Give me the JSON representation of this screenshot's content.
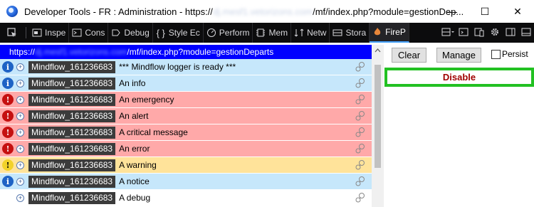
{
  "window": {
    "title_prefix": "Developer Tools - FR : Administration - https://",
    "title_blur": "dj.mesf1.vetorizons.com",
    "title_suffix": "/mf/index.php?module=gestionDep...",
    "minimize_glyph": "—",
    "maximize_glyph": "☐",
    "close_glyph": "✕"
  },
  "toolbar": {
    "tabs": [
      {
        "label": "Inspe",
        "icon": "inspector-icon"
      },
      {
        "label": "Cons",
        "icon": "console-icon"
      },
      {
        "label": "Debug",
        "icon": "debugger-icon"
      },
      {
        "label": "Style Ec",
        "icon": "style-editor-icon"
      },
      {
        "label": "Perform",
        "icon": "performance-icon"
      },
      {
        "label": "Mem",
        "icon": "memory-icon"
      },
      {
        "label": "Netw",
        "icon": "network-icon"
      },
      {
        "label": "Stora",
        "icon": "storage-icon"
      },
      {
        "label": "FireP",
        "icon": "firephp-icon"
      }
    ]
  },
  "url": {
    "prefix": "https://",
    "blur": "dj.mesf1.vetorizons.com",
    "suffix": "/mf/index.php?module=gestionDeparts"
  },
  "log": {
    "logger_name": "Mindflow_161236683",
    "entries": [
      {
        "level": "info",
        "message": "*** Mindflow logger is ready ***"
      },
      {
        "level": "info",
        "message": "An info"
      },
      {
        "level": "error",
        "message": "An emergency"
      },
      {
        "level": "error",
        "message": "An alert"
      },
      {
        "level": "error",
        "message": "A critical message"
      },
      {
        "level": "error",
        "message": "An error"
      },
      {
        "level": "warning",
        "message": "A warning"
      },
      {
        "level": "info",
        "message": "A notice"
      },
      {
        "level": "debug",
        "message": "A debug"
      }
    ]
  },
  "panel": {
    "clear_label": "Clear",
    "manage_label": "Manage",
    "persist_label": "Persist",
    "disable_label": "Disable"
  },
  "colors": {
    "url_bar": "#0000ff",
    "info_row": "#c6e7fb",
    "error_row": "#ffa9a9",
    "warning_row": "#ffe39a",
    "disable_border": "#22c122",
    "disable_text": "#a00000"
  }
}
